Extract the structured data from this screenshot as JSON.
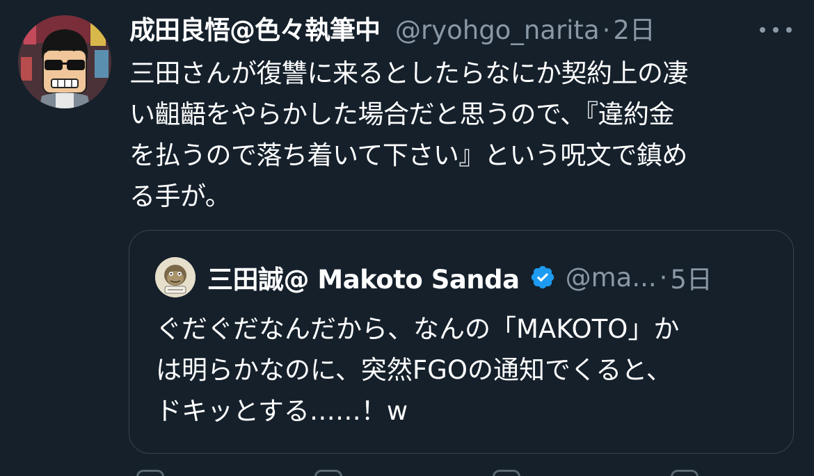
{
  "tweet": {
    "author": {
      "display_name": "成田良悟@色々執筆中",
      "handle": "@ryohgo_narita",
      "avatar": "avatar-sunglasses-man"
    },
    "separator": "·",
    "time": "2日",
    "more_icon": "more-horizontal-icon",
    "text_lines": [
      "三田さんが復讐に来るとしたらなにか契約上の凄",
      "い齟齬をやらかした場合だと思うので、『違約金",
      "を払うので落ち着いて下さい』という呪文で鎮め",
      "る手が。"
    ]
  },
  "quote": {
    "author": {
      "display_name": "三田誠@ Makoto Sanda",
      "handle": "@ma...",
      "verified_icon": "verified-badge-icon",
      "avatar": "avatar-cartoon-character"
    },
    "separator": "·",
    "time": "5日",
    "text_lines": [
      "ぐだぐだなんだから、なんの「MAKOTO」か",
      "は明らかなのに、突然FGOの通知でくると、",
      "ドキッとする……！w"
    ]
  },
  "colors": {
    "background": "#15202b",
    "text_primary": "#ffffff",
    "text_secondary": "#8b98a5",
    "border": "#38444d",
    "verified_blue": "#1d9bf0"
  }
}
